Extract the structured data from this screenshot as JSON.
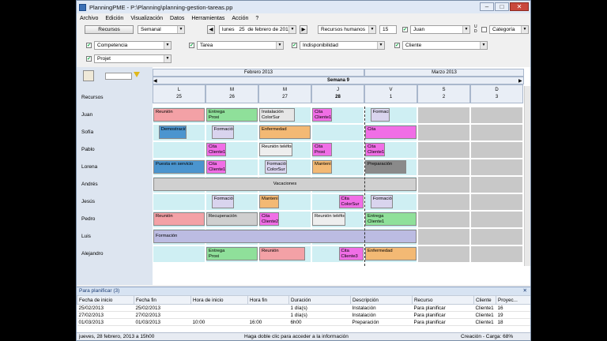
{
  "window": {
    "title": "PlanningPME - P:\\Planning\\planning-gestion-tareas.pp",
    "min": "–",
    "max": "□",
    "close": "✕"
  },
  "menu": [
    "Archivo",
    "Edición",
    "Visualización",
    "Datos",
    "Herramientas",
    "Acción",
    "?"
  ],
  "toolbar": {
    "resources_button": "Recursos",
    "view": "Semanal",
    "date_day": "lunes",
    "date_num": "25",
    "date_month": "de febrero de 201",
    "resource_type": "Recursos humanos",
    "spin_value": "15",
    "user": "Juan",
    "ud": "U\nD",
    "category": "Categoría",
    "filter1": "Competencia",
    "filter2": "Tarea",
    "filter3": "Indisponibilidad",
    "filter4": "Cliente",
    "filter5": "Projet"
  },
  "grid": {
    "month_left": "Febrero 2013",
    "month_right": "Marzo 2013",
    "week": "Semana 9",
    "resources_header": "Recursos",
    "days": [
      {
        "letter": "L",
        "num": "25"
      },
      {
        "letter": "M",
        "num": "26"
      },
      {
        "letter": "M",
        "num": "27"
      },
      {
        "letter": "J",
        "num": "28"
      },
      {
        "letter": "V",
        "num": "1"
      },
      {
        "letter": "S",
        "num": "2"
      },
      {
        "letter": "D",
        "num": "3"
      }
    ],
    "resources": [
      "Juan",
      "Sofía",
      "Pablo",
      "Lorena",
      "Andrés",
      "Jesús",
      "Pedro",
      "Luis",
      "Alejandro"
    ],
    "events": [
      {
        "text": "Reunión",
        "color": "#f3a1a6"
      },
      {
        "text": "Entrega\nProxi",
        "color": "#8fe09a"
      },
      {
        "text": "Instalación\nColorSur",
        "color": "#e6e6e6"
      },
      {
        "text": "Cita\nCliente1",
        "color": "#f06ee6"
      },
      {
        "text": "Formación",
        "color": "#d9d4ee"
      },
      {
        "text": "Demostración",
        "color": "#4b95cf"
      },
      {
        "text": "Formación",
        "color": "#d9d4ee"
      },
      {
        "text": "Enfermedad",
        "color": "#f3b974"
      },
      {
        "text": "Cita",
        "color": "#f06ee6"
      },
      {
        "text": "Cita\nCliente1",
        "color": "#f06ee6"
      },
      {
        "text": "Reunión teléfon",
        "color": "#eeeeee"
      },
      {
        "text": "Cita\nProxi",
        "color": "#f06ee6"
      },
      {
        "text": "Cita\nCliente1",
        "color": "#f06ee6"
      },
      {
        "text": "Puesta en servicio",
        "color": "#4b95cf"
      },
      {
        "text": "Cita\nCliente1",
        "color": "#f06ee6"
      },
      {
        "text": "Formación\nColorSur",
        "color": "#d9d4ee"
      },
      {
        "text": "Mantenim",
        "color": "#f3b974"
      },
      {
        "text": "Preparación",
        "color": "#8a8a8a"
      },
      {
        "text": "Vacaciones",
        "color": "#d0d0d0"
      },
      {
        "text": "Formación",
        "color": "#d9d4ee"
      },
      {
        "text": "Mantenim",
        "color": "#f3b974"
      },
      {
        "text": "Cita\nColorSur",
        "color": "#f06ee6"
      },
      {
        "text": "Formación",
        "color": "#d9d4ee"
      },
      {
        "text": "Reunión",
        "color": "#f3a1a6"
      },
      {
        "text": "Recuperación",
        "color": "#cfcfcf"
      },
      {
        "text": "Cita\nCliente2",
        "color": "#f06ee6"
      },
      {
        "text": "Reunión teléfon",
        "color": "#eeeeee"
      },
      {
        "text": "Entrega\nCliente1",
        "color": "#8fe09a"
      },
      {
        "text": "Formación",
        "color": "#bcbce2"
      },
      {
        "text": "Entrega\nProxi",
        "color": "#8fe09a"
      },
      {
        "text": "Reunión",
        "color": "#f3a1a6"
      },
      {
        "text": "Cita\nCliente3",
        "color": "#f06ee6"
      },
      {
        "text": "Enfermedad",
        "color": "#f3b974"
      }
    ]
  },
  "planner": {
    "title": "Para planificar (3)",
    "close": "✕",
    "columns": [
      "Fecha de inicio",
      "Fecha fin",
      "Hora de inicio",
      "Hora fin",
      "Duración",
      "Descripción",
      "Recurso",
      "Cliente",
      "Proyec..."
    ],
    "rows": [
      [
        "25/02/2013",
        "25/02/2013",
        "",
        "",
        "1 día(s)",
        "Instalación",
        "Para planificar",
        "Cliente1",
        "16"
      ],
      [
        "27/02/2013",
        "27/02/2013",
        "",
        "",
        "1 día(s)",
        "Instalación",
        "Para planificar",
        "Cliente1",
        "19"
      ],
      [
        "01/03/2013",
        "01/03/2013",
        "10:00",
        "16:00",
        "6h00",
        "Preparación",
        "Para planificar",
        "Cliente1",
        "18"
      ]
    ]
  },
  "status": {
    "date": "jueves, 28 febrero, 2013 a 15h00",
    "hint": "Haga doble clic para acceder a la información",
    "load": "Creación - Carga: 68%"
  }
}
